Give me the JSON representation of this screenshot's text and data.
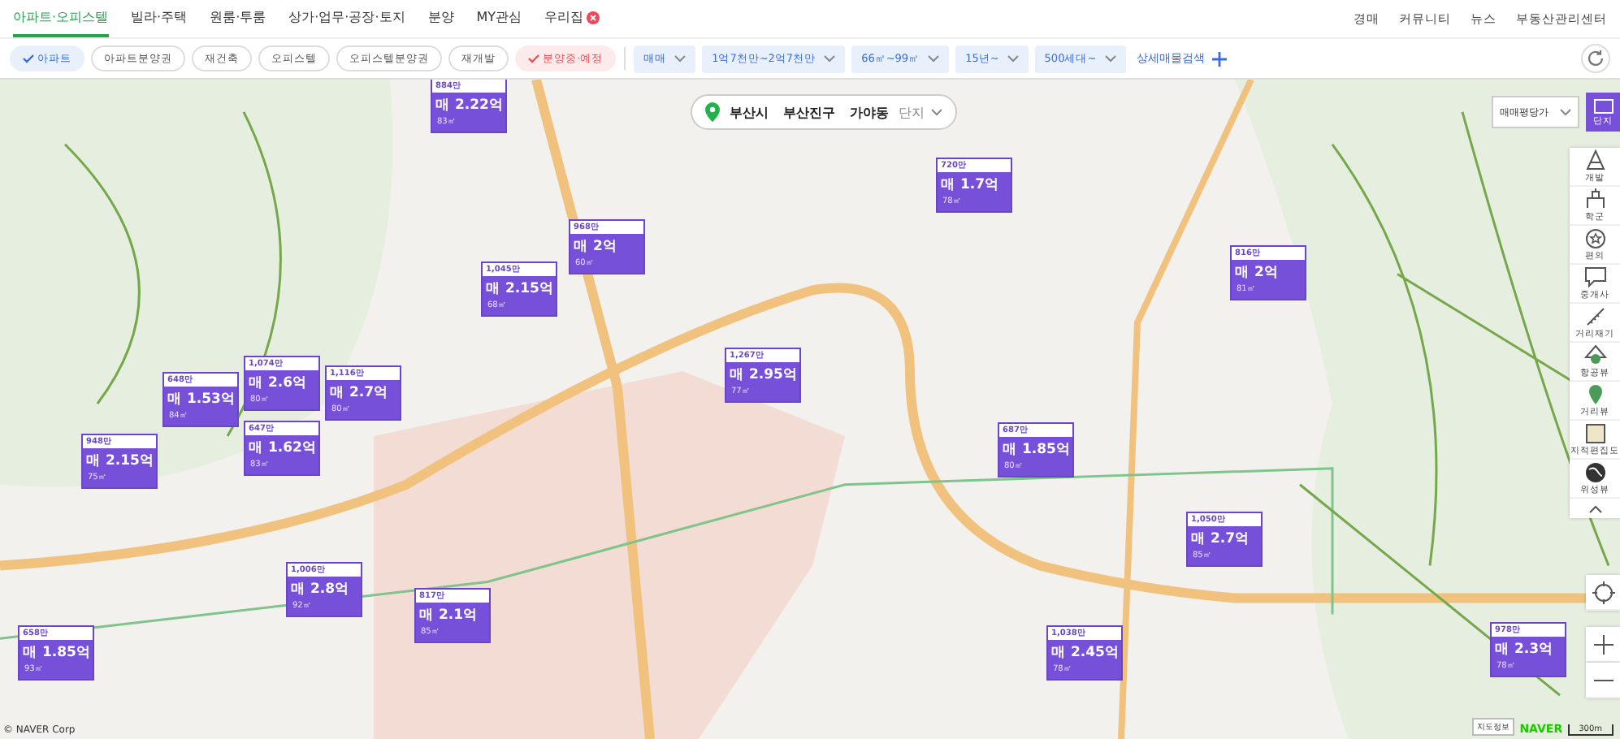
{
  "nav": {
    "tabs": [
      {
        "label": "아파트·오피스텔",
        "selected": true,
        "badge": false
      },
      {
        "label": "빌라·주택",
        "selected": false,
        "badge": false
      },
      {
        "label": "원룸·투룸",
        "selected": false,
        "badge": false
      },
      {
        "label": "상가·업무·공장·토지",
        "selected": false,
        "badge": false
      },
      {
        "label": "분양",
        "selected": false,
        "badge": false
      },
      {
        "label": "MY관심",
        "selected": false,
        "badge": false
      },
      {
        "label": "우리집",
        "selected": false,
        "badge": true
      }
    ],
    "links": [
      "경매",
      "커뮤니티",
      "뉴스",
      "부동산관리센터"
    ]
  },
  "filters": {
    "chips": [
      {
        "label": "아파트",
        "checked": true,
        "kind": "type"
      },
      {
        "label": "아파트분양권",
        "checked": false,
        "kind": "type"
      },
      {
        "label": "재건축",
        "checked": false,
        "kind": "type"
      },
      {
        "label": "오피스텔",
        "checked": false,
        "kind": "type"
      },
      {
        "label": "오피스텔분양권",
        "checked": false,
        "kind": "type"
      },
      {
        "label": "재개발",
        "checked": false,
        "kind": "type"
      },
      {
        "label": "분양중·예정",
        "checked": true,
        "kind": "presale"
      }
    ],
    "dropdowns": [
      "매매",
      "1억7천만~2억7천만",
      "66㎡~99㎡",
      "15년~",
      "500세대~"
    ],
    "detail_search": "상세매물검색"
  },
  "map": {
    "location": [
      "부산시",
      "부산진구",
      "가야동"
    ],
    "location_mode": "단지",
    "price_select": "매매평당가",
    "complex_button": "단지",
    "tools": [
      "개발",
      "학군",
      "편의",
      "중개사",
      "거리재기",
      "항공뷰",
      "거리뷰",
      "지적편집도",
      "위성뷰"
    ],
    "markers": [
      {
        "unit": "884만",
        "price": "매 2.22억",
        "area": "83㎡"
      },
      {
        "unit": "968만",
        "price": "매 2억",
        "area": "60㎡"
      },
      {
        "unit": "1,045만",
        "price": "매 2.15억",
        "area": "68㎡"
      },
      {
        "unit": "1,074만",
        "price": "매 2.6억",
        "area": "80㎡"
      },
      {
        "unit": "1,116만",
        "price": "매 2.7억",
        "area": "80㎡"
      },
      {
        "unit": "648만",
        "price": "매 1.53억",
        "area": "84㎡"
      },
      {
        "unit": "647만",
        "price": "매 1.62억",
        "area": "83㎡"
      },
      {
        "unit": "948만",
        "price": "매 2.15억",
        "area": "75㎡"
      },
      {
        "unit": "1,267만",
        "price": "매 2.95억",
        "area": "77㎡"
      },
      {
        "unit": "720만",
        "price": "매 1.7억",
        "area": "78㎡"
      },
      {
        "unit": "816만",
        "price": "매 2억",
        "area": "81㎡"
      },
      {
        "unit": "687만",
        "price": "매 1.85억",
        "area": "80㎡"
      },
      {
        "unit": "1,050만",
        "price": "매 2.7억",
        "area": "85㎡"
      },
      {
        "unit": "1,006만",
        "price": "매 2.8억",
        "area": "92㎡"
      },
      {
        "unit": "817만",
        "price": "매 2.1억",
        "area": "85㎡"
      },
      {
        "unit": "658만",
        "price": "매 1.85억",
        "area": "93㎡"
      },
      {
        "unit": "1,038만",
        "price": "매 2.45억",
        "area": "78㎡"
      },
      {
        "unit": "978만",
        "price": "매 2.3억",
        "area": "78㎡"
      }
    ],
    "copyright": "© NAVER Corp",
    "map_info": "지도정보",
    "logo": "NAVER",
    "scale": "300m"
  }
}
